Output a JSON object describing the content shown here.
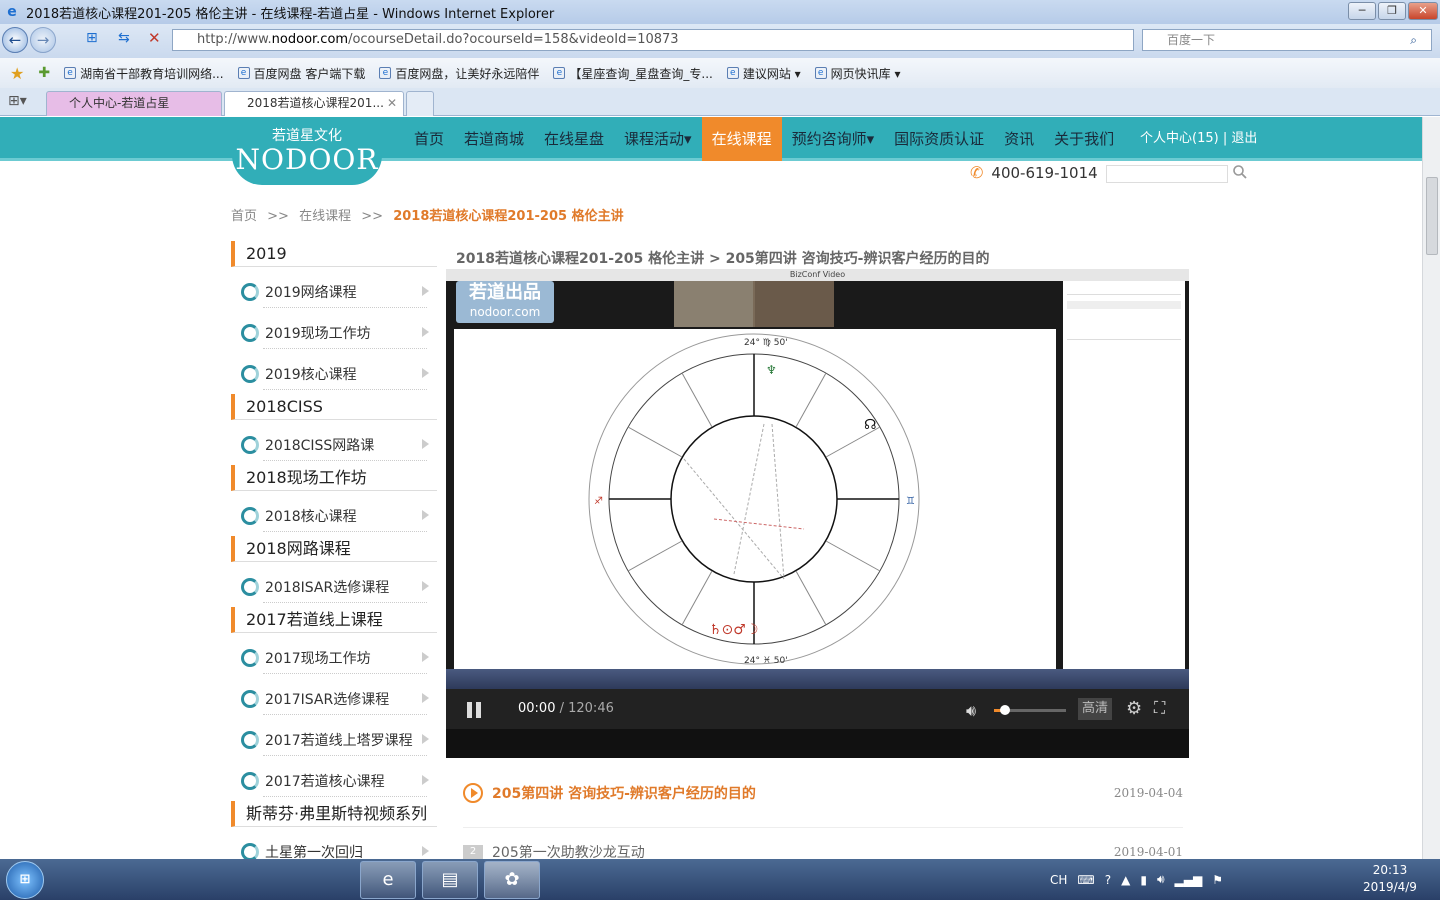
{
  "window": {
    "title": "2018若道核心课程201-205 格伦主讲 - 在线课程-若道占星 - Windows Internet Explorer",
    "url_prefix": "http://www.",
    "url_domain": "nodoor.com",
    "url_path": "/ocourseDetail.do?ocourseId=158&videoId=10873",
    "search_placeholder": "百度一下"
  },
  "favorites": [
    {
      "label": "湖南省干部教育培训网络..."
    },
    {
      "label": "百度网盘 客户端下载"
    },
    {
      "label": "百度网盘，让美好永远陪伴"
    },
    {
      "label": "【星座查询_星盘查询_专..."
    },
    {
      "label": "建议网站 ▾"
    },
    {
      "label": "网页快讯库 ▾"
    }
  ],
  "tabs": [
    {
      "label": "个人中心-若道占星"
    },
    {
      "label": "2018若道核心课程201..."
    }
  ],
  "site": {
    "logo_cn": "若道星文化",
    "logo_en": "NODOOR",
    "nav": [
      "首页",
      "若道商城",
      "在线星盘",
      "课程活动▾",
      "在线课程",
      "预约咨询师▾",
      "国际资质认证",
      "资讯",
      "关于我们"
    ],
    "user_center": "个人中心(15)",
    "logout": "退出",
    "phone": "400-619-1014"
  },
  "breadcrumb": {
    "home": "首页",
    "sep": ">>",
    "section": "在线课程",
    "current": "2018若道核心课程201-205 格伦主讲"
  },
  "sidebar": [
    {
      "category": "2019",
      "items": [
        "2019网络课程",
        "2019现场工作坊",
        "2019核心课程"
      ]
    },
    {
      "category": "2018CISS",
      "items": [
        "2018CISS网路课"
      ]
    },
    {
      "category": "2018现场工作坊",
      "items": [
        "2018核心课程"
      ]
    },
    {
      "category": "2018网路课程",
      "items": [
        "2018ISAR选修课程"
      ]
    },
    {
      "category": "2017若道线上课程",
      "items": [
        "2017现场工作坊",
        "2017ISAR选修课程",
        "2017若道线上塔罗课程",
        "2017若道核心课程"
      ]
    },
    {
      "category": "斯蒂芬·弗里斯特视频系列",
      "items": [
        "土星第一次回归"
      ]
    }
  ],
  "video": {
    "heading": "2018若道核心课程201-205 格伦主讲 > 205第四讲 咨询技巧-辨识客户经历的目的",
    "window_title": "BizConf Video",
    "brand_cn": "若道出品",
    "brand_en": "nodoor.com",
    "current_time": "00:00",
    "duration": "/ 120:46",
    "quality": "高清",
    "volume": 0.15
  },
  "lessons": [
    {
      "num": "",
      "name": "205第四讲  咨询技巧-辨识客户经历的目的",
      "date": "2019-04-04",
      "active": true
    },
    {
      "num": "2",
      "name": "205第一次助教沙龙互动",
      "date": "2019-04-01",
      "active": false
    }
  ],
  "taskbar": {
    "lang": "CH",
    "time": "20:13",
    "date": "2019/4/9"
  }
}
